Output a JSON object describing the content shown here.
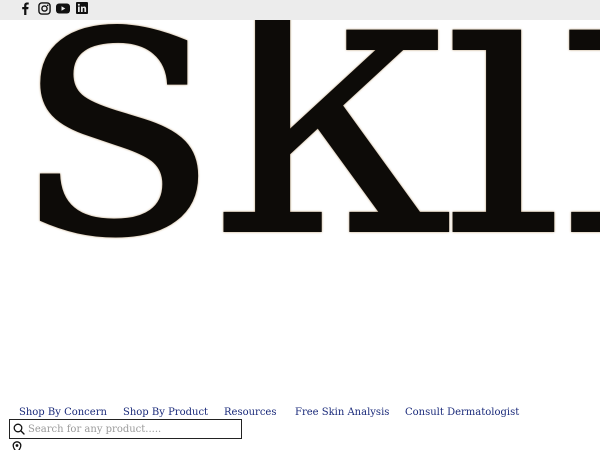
{
  "social": [
    {
      "icon": "facebook-icon"
    },
    {
      "icon": "instagram-icon"
    },
    {
      "icon": "youtube-icon"
    },
    {
      "icon": "linkedin-icon"
    }
  ],
  "logo": {
    "text": "skin"
  },
  "nav": {
    "items": [
      {
        "label": "Shop By Concern"
      },
      {
        "label": "Shop By Product"
      },
      {
        "label": "Resources"
      },
      {
        "label": "Free Skin Analysis"
      },
      {
        "label": "Consult Dermatologist"
      }
    ]
  },
  "search": {
    "placeholder": "Search for any product....."
  },
  "colors": {
    "nav_link": "#1a2a7a",
    "topbar": "#ececec",
    "logo": "#0d0b08"
  }
}
